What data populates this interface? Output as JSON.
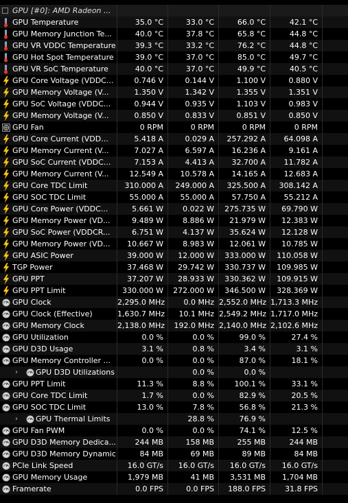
{
  "header": {
    "title": "GPU [#0]: AMD Radeon ..."
  },
  "rows": [
    {
      "name": "GPU Temperature",
      "icon": "thermometer-icon",
      "v": [
        "35.0 °C",
        "33.0 °C",
        "66.0 °C",
        "42.1 °C"
      ]
    },
    {
      "name": "GPU Memory Junction Te...",
      "icon": "thermometer-icon",
      "v": [
        "40.0 °C",
        "37.8 °C",
        "65.8 °C",
        "44.8 °C"
      ]
    },
    {
      "name": "GPU VR VDDC Temperature",
      "icon": "thermometer-icon",
      "v": [
        "39.3 °C",
        "33.2 °C",
        "76.2 °C",
        "44.8 °C"
      ]
    },
    {
      "name": "GPU Hot Spot Temperature",
      "icon": "thermometer-icon",
      "v": [
        "39.0 °C",
        "37.0 °C",
        "85.0 °C",
        "49.7 °C"
      ]
    },
    {
      "name": "GPU VR SoC Temperature",
      "icon": "thermometer-icon",
      "v": [
        "40.0 °C",
        "37.0 °C",
        "49.9 °C",
        "40.5 °C"
      ]
    },
    {
      "name": "GPU Core Voltage (VDDC...",
      "icon": "lightning-icon",
      "v": [
        "0.746 V",
        "0.144 V",
        "1.100 V",
        "0.880 V"
      ]
    },
    {
      "name": "GPU Memory Voltage (V...",
      "icon": "lightning-icon",
      "v": [
        "1.350 V",
        "1.342 V",
        "1.355 V",
        "1.351 V"
      ]
    },
    {
      "name": "GPU SoC Voltage (VDDC...",
      "icon": "lightning-icon",
      "v": [
        "0.944 V",
        "0.935 V",
        "1.103 V",
        "0.983 V"
      ]
    },
    {
      "name": "GPU Memory Voltage (V...",
      "icon": "lightning-icon",
      "v": [
        "0.850 V",
        "0.833 V",
        "0.851 V",
        "0.850 V"
      ]
    },
    {
      "name": "GPU Fan",
      "icon": "fan-icon",
      "v": [
        "0 RPM",
        "0 RPM",
        "0 RPM",
        "0 RPM"
      ]
    },
    {
      "name": "GPU Core Current (VDD...",
      "icon": "lightning-icon",
      "v": [
        "5.418 A",
        "0.029 A",
        "257.292 A",
        "64.098 A"
      ]
    },
    {
      "name": "GPU Memory Current (V...",
      "icon": "lightning-icon",
      "v": [
        "7.027 A",
        "6.597 A",
        "16.236 A",
        "9.161 A"
      ]
    },
    {
      "name": "GPU SoC Current (VDDC...",
      "icon": "lightning-icon",
      "v": [
        "7.153 A",
        "4.413 A",
        "32.700 A",
        "11.782 A"
      ]
    },
    {
      "name": "GPU Memory Current (V...",
      "icon": "lightning-icon",
      "v": [
        "12.549 A",
        "10.578 A",
        "14.165 A",
        "12.683 A"
      ]
    },
    {
      "name": "GPU Core TDC Limit",
      "icon": "lightning-icon",
      "v": [
        "310.000 A",
        "249.000 A",
        "325.500 A",
        "308.142 A"
      ]
    },
    {
      "name": "GPU SOC TDC Limit",
      "icon": "lightning-icon",
      "v": [
        "55.000 A",
        "55.000 A",
        "57.750 A",
        "55.212 A"
      ]
    },
    {
      "name": "GPU Core Power (VDDC...",
      "icon": "lightning-icon",
      "v": [
        "5.661 W",
        "0.022 W",
        "275.735 W",
        "69.790 W"
      ]
    },
    {
      "name": "GPU Memory Power (VD...",
      "icon": "lightning-icon",
      "v": [
        "9.489 W",
        "8.886 W",
        "21.979 W",
        "12.383 W"
      ]
    },
    {
      "name": "GPU SoC Power (VDDCR...",
      "icon": "lightning-icon",
      "v": [
        "6.751 W",
        "4.137 W",
        "35.624 W",
        "12.128 W"
      ]
    },
    {
      "name": "GPU Memory Power (VD...",
      "icon": "lightning-icon",
      "v": [
        "10.667 W",
        "8.983 W",
        "12.061 W",
        "10.785 W"
      ]
    },
    {
      "name": "GPU ASIC Power",
      "icon": "lightning-icon",
      "v": [
        "39.000 W",
        "12.000 W",
        "333.000 W",
        "110.058 W"
      ]
    },
    {
      "name": "TGP Power",
      "icon": "lightning-icon",
      "v": [
        "37.468 W",
        "29.742 W",
        "330.737 W",
        "109.985 W"
      ]
    },
    {
      "name": "GPU PPT",
      "icon": "lightning-icon",
      "v": [
        "37.207 W",
        "28.933 W",
        "330.362 W",
        "109.915 W"
      ]
    },
    {
      "name": "GPU PPT Limit",
      "icon": "lightning-icon",
      "v": [
        "330.000 W",
        "272.000 W",
        "346.500 W",
        "328.369 W"
      ]
    },
    {
      "name": "GPU Clock",
      "icon": "gauge-icon",
      "v": [
        "2,295.0 MHz",
        "0.0 MHz",
        "2,552.0 MHz",
        "1,713.3 MHz"
      ]
    },
    {
      "name": "GPU Clock (Effective)",
      "icon": "gauge-icon",
      "v": [
        "1,630.7 MHz",
        "10.1 MHz",
        "2,549.2 MHz",
        "1,717.0 MHz"
      ]
    },
    {
      "name": "GPU Memory Clock",
      "icon": "gauge-icon",
      "v": [
        "2,138.0 MHz",
        "192.0 MHz",
        "2,140.0 MHz",
        "2,102.6 MHz"
      ]
    },
    {
      "name": "GPU Utilization",
      "icon": "gauge-icon",
      "v": [
        "0.0 %",
        "0.0 %",
        "99.0 %",
        "27.4 %"
      ]
    },
    {
      "name": "GPU D3D Usage",
      "icon": "gauge-icon",
      "v": [
        "3.1 %",
        "0.8 %",
        "3.4 %",
        "3.1 %"
      ]
    },
    {
      "name": "GPU Memory Controller ...",
      "icon": "gauge-icon",
      "v": [
        "0.0 %",
        "0.0 %",
        "87.0 %",
        "18.1 %"
      ]
    },
    {
      "name": "GPU D3D Utilizations",
      "icon": "gauge-icon",
      "sub": true,
      "v": [
        "",
        "0.0 %",
        "0.0 %",
        ""
      ]
    },
    {
      "name": "GPU PPT Limit",
      "icon": "gauge-icon",
      "v": [
        "11.3 %",
        "8.8 %",
        "100.1 %",
        "33.1 %"
      ]
    },
    {
      "name": "GPU Core TDC Limit",
      "icon": "gauge-icon",
      "v": [
        "1.7 %",
        "0.0 %",
        "82.9 %",
        "20.5 %"
      ]
    },
    {
      "name": "GPU SOC TDC Limit",
      "icon": "gauge-icon",
      "v": [
        "13.0 %",
        "7.8 %",
        "56.8 %",
        "21.3 %"
      ]
    },
    {
      "name": "GPU Thermal Limits",
      "icon": "gauge-icon",
      "sub": true,
      "v": [
        "",
        "28.8 %",
        "76.9 %",
        ""
      ]
    },
    {
      "name": "GPU Fan PWM",
      "icon": "gauge-icon",
      "v": [
        "0.0 %",
        "0.0 %",
        "74.1 %",
        "12.5 %"
      ]
    },
    {
      "name": "GPU D3D Memory Dedica...",
      "icon": "gauge-icon",
      "v": [
        "244 MB",
        "158 MB",
        "255 MB",
        "244 MB"
      ]
    },
    {
      "name": "GPU D3D Memory Dynamic",
      "icon": "gauge-icon",
      "v": [
        "84 MB",
        "69 MB",
        "89 MB",
        "84 MB"
      ]
    },
    {
      "name": "PCIe Link Speed",
      "icon": "gauge-icon",
      "v": [
        "16.0 GT/s",
        "16.0 GT/s",
        "16.0 GT/s",
        "16.0 GT/s"
      ]
    },
    {
      "name": "GPU Memory Usage",
      "icon": "gauge-icon",
      "v": [
        "1,979 MB",
        "41 MB",
        "3,531 MB",
        "1,704 MB"
      ]
    },
    {
      "name": "Framerate",
      "icon": "gauge-icon",
      "v": [
        "0.0 FPS",
        "0.0 FPS",
        "188.0 FPS",
        "31.8 FPS"
      ]
    }
  ],
  "colors": {
    "background": "#000000",
    "alt_row": "#111111",
    "text": "#ffffff",
    "lightning": "#f5c518",
    "thermo_red": "#d93a2b",
    "thermo_blue": "#3c7dd9",
    "gauge": "#d0d0d0"
  }
}
